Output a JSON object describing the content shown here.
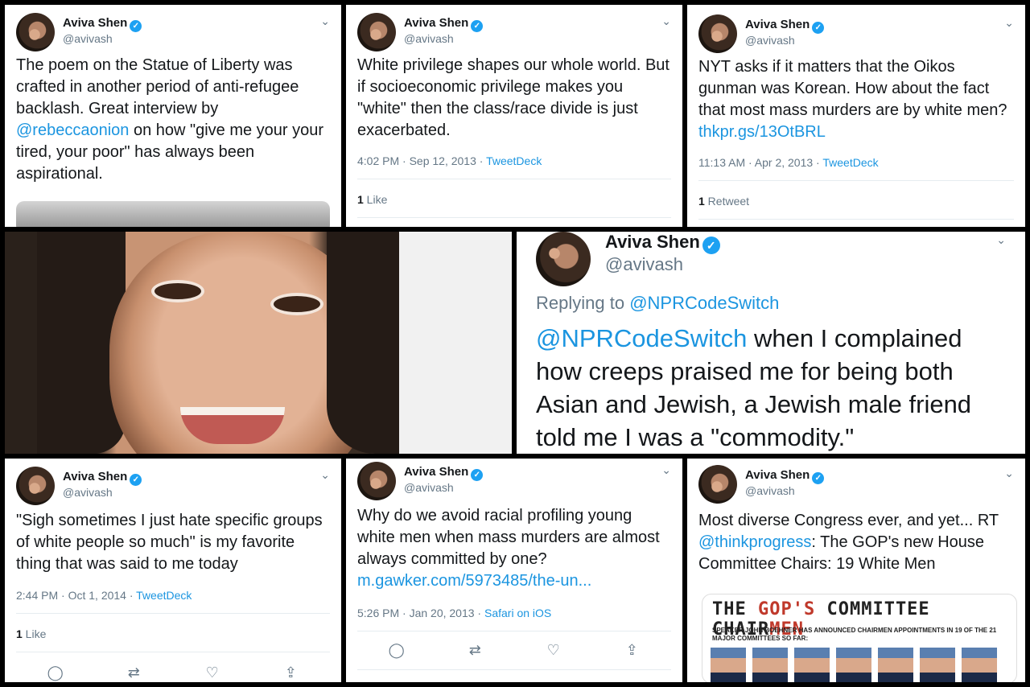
{
  "tweets": [
    {
      "name": "Aviva Shen",
      "handle": "@avivash",
      "text_before": "The poem on the Statue of Liberty was crafted in another period of anti-refugee backlash. Great interview by ",
      "mention": "@rebeccaonion",
      "text_after": " on how \"give me your your tired, your poor\" has always been aspirational."
    },
    {
      "name": "Aviva Shen",
      "handle": "@avivash",
      "text": "White privilege shapes our whole world. But if socioeconomic privilege makes you \"white\" then the class/race divide is just exacerbated.",
      "time": "4:02 PM · Sep 12, 2013 · ",
      "source": "TweetDeck",
      "stat_count": "1",
      "stat_label": " Like"
    },
    {
      "name": "Aviva Shen",
      "handle": "@avivash",
      "text": "NYT asks if it matters that the Oikos gunman was Korean. How about the fact that most mass murders are by white men? ",
      "link": "thkpr.gs/13OtBRL",
      "time": "11:13 AM · Apr 2, 2013 · ",
      "source": "TweetDeck",
      "stat_count": "1",
      "stat_label": " Retweet"
    },
    {
      "name": "Aviva Shen",
      "handle": "@avivash",
      "replying_prefix": "Replying to ",
      "replying_to": "@NPRCodeSwitch",
      "mention": "@NPRCodeSwitch",
      "text": " when I complained how creeps praised me for being both Asian and Jewish, a Jewish male friend told me I was a \"commodity.\""
    },
    {
      "name": "Aviva Shen",
      "handle": "@avivash",
      "text": "\"Sigh sometimes I just hate specific groups of white people so much\" is my favorite thing that was said to me today",
      "time": "2:44 PM · Oct 1, 2014 · ",
      "source": "TweetDeck",
      "stat_count": "1",
      "stat_label": " Like"
    },
    {
      "name": "Aviva Shen",
      "handle": "@avivash",
      "text": "Why do we avoid racial profiling young white men when mass murders are almost always committed by one? ",
      "link": "m.gawker.com/5973485/the-un...",
      "time": "5:26 PM · Jan 20, 2013 · ",
      "source": "Safari on iOS"
    },
    {
      "name": "Aviva Shen",
      "handle": "@avivash",
      "text_before": "Most diverse Congress ever, and yet... RT ",
      "mention": "@thinkprogress",
      "text_after": ": The GOP's new House Committee Chairs: 19 White Men",
      "image_title_a": "THE ",
      "image_title_b": "GOP'S ",
      "image_title_c": "COMMITTEE CHAIR",
      "image_title_d": "MEN",
      "image_sub": "SPEAKER JOHN BOEHNER HAS ANNOUNCED CHAIRMEN APPOINTMENTS IN 19 OF THE 21 MAJOR COMMITTEES SO FAR:"
    }
  ],
  "icons": {
    "verified": "verified-check-icon",
    "chevron": "chevron-down-icon",
    "reply": "reply-icon",
    "retweet": "retweet-icon",
    "like": "heart-icon",
    "share": "share-icon"
  },
  "glyphs": {
    "verified": "✓",
    "chevron": "⌄",
    "reply": "◯",
    "retweet": "⇄",
    "like": "♡",
    "share": "⇪"
  },
  "colors": {
    "link": "#1b95e0",
    "verified": "#1da1f2",
    "muted": "#657786"
  }
}
